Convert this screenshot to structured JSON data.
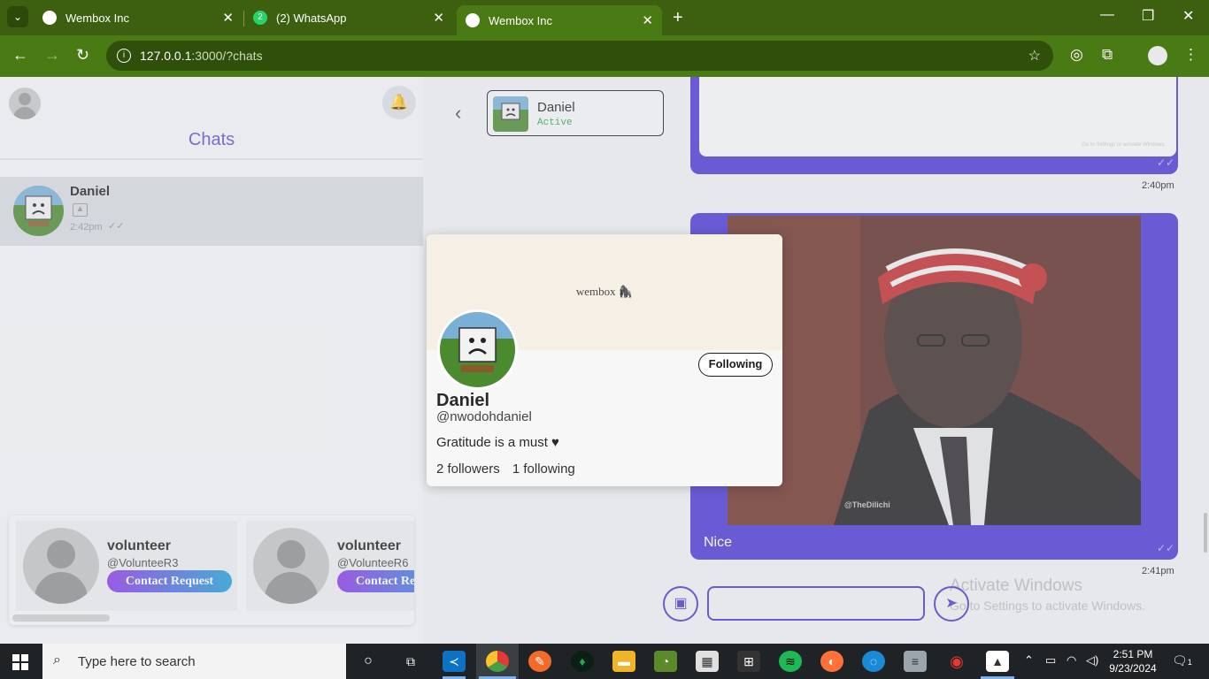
{
  "browser": {
    "tabs": [
      {
        "title": "Wembox Inc",
        "favicon": "wembox-icon",
        "active": false
      },
      {
        "title": "(2) WhatsApp",
        "favicon": "whatsapp-icon",
        "badge": "2",
        "active": false
      },
      {
        "title": "Wembox Inc",
        "favicon": "wembox-icon",
        "active": true
      }
    ],
    "url_host": "127.0.0.1",
    "url_rest": ":3000/?chats",
    "theme_color": "#4a7a14"
  },
  "sidebar": {
    "title": "Chats",
    "chats": [
      {
        "name": "Daniel",
        "preview_icon": "image-icon",
        "time": "2:42pm",
        "ticks": "✓✓"
      }
    ],
    "suggestions": [
      {
        "name": "volunteer",
        "handle": "@VolunteeR3",
        "button": "Contact Request"
      },
      {
        "name": "volunteer",
        "handle": "@VolunteeR6",
        "button": "Contact Request"
      }
    ]
  },
  "chat": {
    "contact_name": "Daniel",
    "contact_status": "Active",
    "messages": [
      {
        "type": "image",
        "watermark": "Go to Settings to activate Windows.",
        "time": "2:40pm",
        "ticks": "✓✓"
      },
      {
        "type": "image",
        "image_caption": "@TheDilichi",
        "text": "Nice",
        "time": "2:41pm",
        "ticks": "✓✓"
      }
    ],
    "accent": "#4a36d4"
  },
  "profile_popover": {
    "brand": "wembox 🦍",
    "follow_label": "Following",
    "name": "Daniel",
    "handle": "@nwodohdaniel",
    "bio": "Gratitude is a must ♥",
    "followers": "2 followers",
    "following": "1 following"
  },
  "watermark": {
    "line1": "Activate Windows",
    "line2": "Go to Settings to activate Windows."
  },
  "taskbar": {
    "search_placeholder": "Type here to search",
    "time": "2:51 PM",
    "date": "9/23/2024",
    "notification_count": "1"
  }
}
